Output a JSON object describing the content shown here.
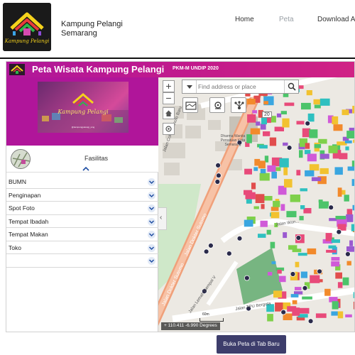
{
  "site": {
    "title": "Kampung Pelangi Semarang",
    "logo_text": "Kampung Pelangi",
    "nav": [
      {
        "label": "Home",
        "active": false
      },
      {
        "label": "Peta",
        "active": true
      },
      {
        "label": "Download A",
        "active": false
      }
    ]
  },
  "app": {
    "title": "Peta Wisata Kampung Pelangi",
    "subtitle": "PKM-M UNDIP 2020",
    "accent": "#c41b8a",
    "banner": {
      "script_text": "Kampung Pelangi",
      "footer_text": "@kampungpelangi_smg"
    },
    "facilities": {
      "heading": "Fasilitas",
      "items": [
        {
          "label": "BUMN"
        },
        {
          "label": "Penginapan"
        },
        {
          "label": "Spot Foto"
        },
        {
          "label": "Tempat Ibadah"
        },
        {
          "label": "Tempat Makan"
        },
        {
          "label": "Toko"
        },
        {
          "label": ""
        }
      ]
    },
    "map": {
      "search_placeholder": "Find address or place",
      "zoom_in": "+",
      "zoom_out": "−",
      "coords": "110.411 -6.990 Degrees",
      "coords_prefix": "+",
      "scale_label": "60m",
      "road_number": "20",
      "roads": {
        "dr_sutomo": "Jalan Dokter Sutomo",
        "dr_sutomo_2": "Jalan Dokter Sutomo",
        "wonosari": "Jalan Won...",
        "tpu_bergota": "Jalan TPU Bergota",
        "gempol": "Jalan Lemah Gempal V",
        "cokro": "Jalan Cokroaminoto Baru",
        "dharma": "Dharma Wanita Persatuan Kota Semarang"
      }
    }
  },
  "actions": {
    "open_map_tab": "Buka Peta di Tab Baru"
  }
}
